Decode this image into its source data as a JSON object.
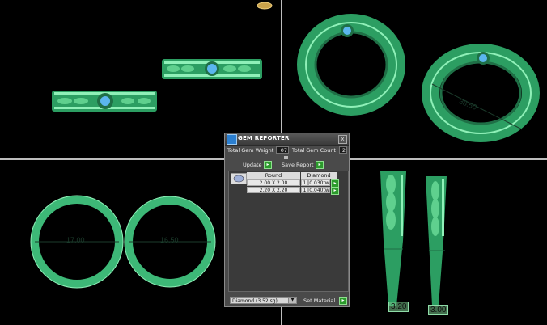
{
  "viewports": {
    "top_left": {
      "name": "ring-flat-view"
    },
    "top_right": {
      "name": "ring-perspective-view",
      "dimension_label": "38.50"
    },
    "bottom_left": {
      "name": "ring-front-view",
      "dimension_labels": [
        "17.00",
        "16.50"
      ]
    },
    "bottom_right": {
      "name": "ring-side-view",
      "dimension_labels": [
        "3.20",
        "3.00"
      ]
    }
  },
  "gem_reporter": {
    "title": "GEM REPORTER",
    "close_glyph": "x",
    "total_gem_weight_label": "Total Gem Weight",
    "total_gem_weight_value": "07",
    "total_gem_count_label": "Total Gem Count",
    "total_gem_count_value": "2",
    "update_label": "Update",
    "save_report_label": "Save Report",
    "go_glyph": "▸",
    "table": {
      "headers": [
        "Round",
        "Diamond"
      ],
      "rows": [
        {
          "size": "2.00 X 2.00",
          "count": "1",
          "weight": "0.030tw"
        },
        {
          "size": "2.20 X 2.20",
          "count": "1",
          "weight": "0.040tw"
        }
      ]
    },
    "material_select": "Diamond    (3.52 sg)",
    "set_material_label": "Set Material"
  },
  "colors": {
    "ring_green": "#3db877",
    "ring_dark": "#1f6f46",
    "ring_highlight": "#8ff0b8",
    "gem_blue": "#4aa8e8",
    "panel_bg": "#4a4a4a",
    "button_green": "#2c9a2c"
  },
  "icons": {
    "gem_reporter_icon": "gem-icon",
    "close": "close-icon",
    "go_buttons": "arrow-right-icon",
    "dropdown": "chevron-down-icon"
  }
}
